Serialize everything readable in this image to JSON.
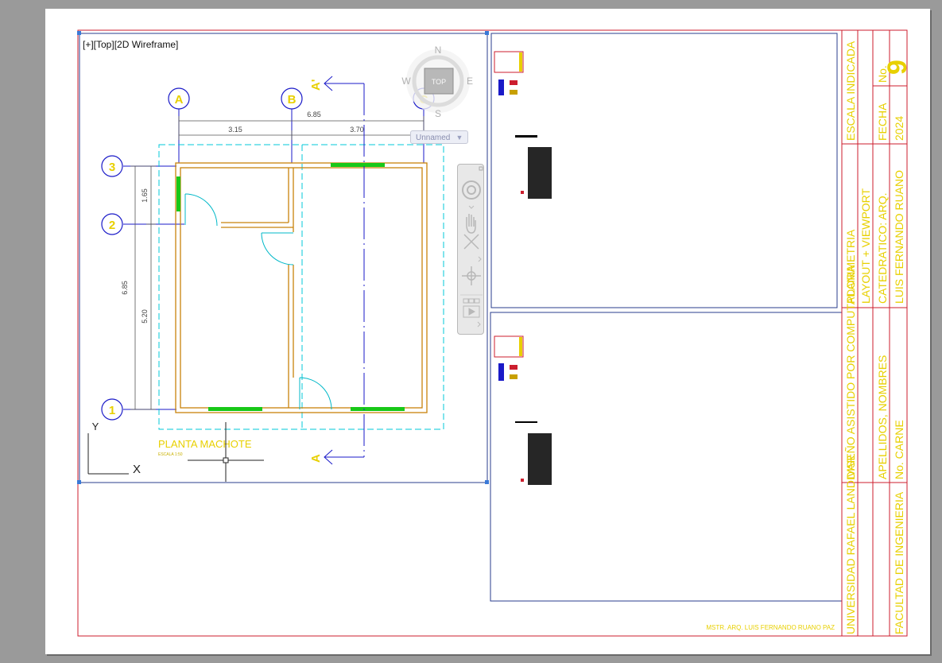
{
  "viewport": {
    "label": "[+][Top][2D Wireframe]",
    "viewcube": {
      "top_face": "TOP",
      "north": "N",
      "south": "S",
      "east": "E",
      "west": "W"
    },
    "ucs_dropdown": "Unnamed",
    "ucs_axes": {
      "x": "X",
      "y": "Y"
    }
  },
  "plan": {
    "grid_columns": [
      "A",
      "B",
      "C"
    ],
    "grid_rows": [
      "3",
      "2",
      "1"
    ],
    "dims_horizontal": {
      "total": "6.85",
      "left": "3.15",
      "right": "3.70"
    },
    "dims_vertical": {
      "total": "6.85",
      "upper": "1.65",
      "lower": "5.20"
    },
    "section_marks": {
      "top": "A'",
      "bottom": "A"
    },
    "title": "PLANTA MACHOTE",
    "scale_note": "ESCALA 1:50"
  },
  "title_block": {
    "col1": "UNIVERSIDAD RAFAEL LANDIVAR",
    "col2": "FACULTAD DE INGENIERIA",
    "sec1_a": "DISEÑO ASISTIDO POR COMPUTADORA",
    "sec1_b": "APELLIDOS, NOMBRES",
    "sec1_c": "No. CARNE",
    "sec2_a": "PLANIMETRIA",
    "sec2_b": "LAYOUT + VIEWPORT",
    "sec2_c": "CATEDRATICO: ARQ.",
    "sec2_d": "LUIS FERNANDO RUANO",
    "sec3_a": "ESCALA INDICADA",
    "sec3_b": "FECHA",
    "sec3_c": "2024",
    "sec3_d": "No.",
    "sheet_number": "9",
    "footer": "MSTR. ARQ. LUIS FERNANDO RUANO PAZ"
  },
  "colors": {
    "border": "#cc1e2e",
    "viewport_frame": "#2a3e8e",
    "grid": "#1a1ac8",
    "bubble_text": "#e8d000",
    "wall": "#c8820a",
    "window": "#18c818",
    "door": "#00b8c8",
    "dashed": "#00c8d8",
    "dim": "#555555"
  }
}
